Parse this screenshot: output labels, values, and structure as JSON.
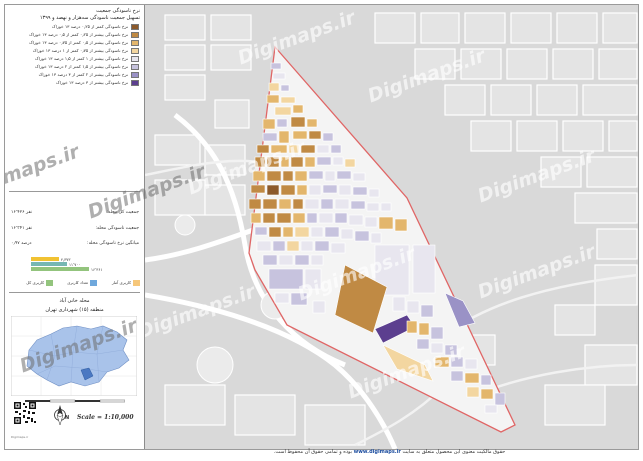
{
  "legend": {
    "title_line1": "نرخ ناسودگی جمعیت",
    "title_line2": "تسهیل جمعیت ناسودگی سه‌هزار و نهصد و ۱۳۹۹",
    "items": [
      {
        "label": "نرخ ناسودگی کمتر از ۰٫۲۵ درصد ۱۳ خوراک",
        "color": "#8c5a2b"
      },
      {
        "label": "نرخ ناسودگی بیشتر از ۰٫۲۵ کمتر از ۰٫۵ درصد ۱۳ خوراک",
        "color": "#c08a44"
      },
      {
        "label": "نرخ ناسودگی بیشتر از ۰٫۵ کمتر از ۰٫۷۵ درصد ۱۳ خوراک",
        "color": "#e3b66c"
      },
      {
        "label": "نرخ ناسودگی بیشتر از ۰٫۷۵ کمتر از ۱ درصد ۱۳ خوراک",
        "color": "#f3d6a0"
      },
      {
        "label": "نرخ ناسودگی بیشتر از ۱ کمتر از ۱٫۵ درصد ۱۳ خوراک",
        "color": "#e8e6ef"
      },
      {
        "label": "نرخ ناسودگی بیشتر از ۱٫۵ کمتر از ۲ درصد ۱۳ خوراک",
        "color": "#c7c3de"
      },
      {
        "label": "نرخ ناسودگی بیشتر از ۲ کمتر از ۳ درصد ۱۳ خوراک",
        "color": "#9a92c6"
      },
      {
        "label": "نرخ ناسودگی بیشتر از ۳ درصد ۱۳ خوراک",
        "color": "#5c3f8f"
      }
    ]
  },
  "stats": [
    {
      "label": "جمعیت کل محله:",
      "value": "۱۶٬۴۲۶ نفر"
    },
    {
      "label": "جمعیت ناسودگی محله:",
      "value": "۱۶٬۳۴۱ نفر"
    },
    {
      "label": "میانگین نرخ ناسودگی محله:",
      "value": "۰٫۹۷ درصد"
    }
  ],
  "bars": [
    {
      "value": "۴٫۳۷۳",
      "color": "#f1c232",
      "fraction": 0.28
    },
    {
      "value": "۱۱٬۷۰۰",
      "color": "#76b7b2",
      "fraction": 0.36
    },
    {
      "value": "۱۶٬۳۶۱",
      "color": "#93c47d",
      "fraction": 0.58
    }
  ],
  "land_use": [
    {
      "label": "کاربری آمار",
      "color": "#f6c77a"
    },
    {
      "label": "تعداد کاربری",
      "color": "#6fa8dc"
    },
    {
      "label": "کاربری کل",
      "color": "#93c47d"
    }
  ],
  "labels": {
    "neighborhood": "محله خانی آباد",
    "district": "منطقه (۱۵) شهرداری تهران",
    "scale": "Scale = 1:10,000",
    "north": "N",
    "qr_caption": "Digimaps.ir"
  },
  "watermarks": [
    "Digimaps.ir",
    "Digimaps.ir",
    "Digimaps.ir",
    "Digimaps.ir",
    "Digimaps.ir",
    "Digimaps.ir",
    "Digimaps.ir",
    "Digimaps.ir",
    "Digimaps.ir",
    "Digimaps.ir",
    "Digimaps.ir"
  ],
  "footer": {
    "text_before": "حقوق مالکیت معنوی این محصول متعلق به سایت",
    "site": "www.digimaps.ir",
    "text_after": "بوده و تمامی حقوق آن محفوظ است."
  },
  "colors": {
    "boundary": "#e06666",
    "map_background": "#d9d9d9",
    "inset_highlight": "#4a78c2",
    "inset_fill": "#a9c3ea"
  }
}
